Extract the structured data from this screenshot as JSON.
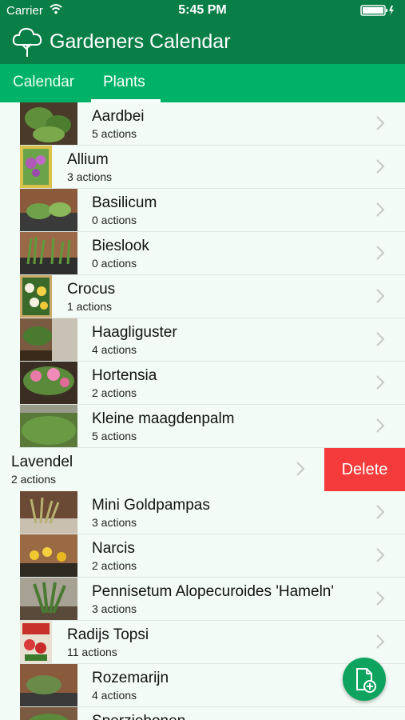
{
  "status": {
    "carrier": "Carrier",
    "time": "5:45 PM"
  },
  "header": {
    "title": "Gardeners Calendar",
    "icon": "tree-cloud-icon"
  },
  "tabs": [
    {
      "label": "Calendar",
      "active": false
    },
    {
      "label": "Plants",
      "active": true
    }
  ],
  "plants": [
    {
      "name": "Aardbei",
      "actions": "5 actions"
    },
    {
      "name": "Allium",
      "actions": "3 actions"
    },
    {
      "name": "Basilicum",
      "actions": "0 actions"
    },
    {
      "name": "Bieslook",
      "actions": "0 actions"
    },
    {
      "name": "Crocus",
      "actions": "1 actions"
    },
    {
      "name": "Haagliguster",
      "actions": "4 actions"
    },
    {
      "name": "Hortensia",
      "actions": "2 actions"
    },
    {
      "name": "Kleine maagdenpalm",
      "actions": "5 actions"
    },
    {
      "name": "Lavendel",
      "actions": "2 actions"
    },
    {
      "name": "Mini Goldpampas",
      "actions": "3 actions"
    },
    {
      "name": "Narcis",
      "actions": "2 actions"
    },
    {
      "name": "Pennisetum Alopecuroides 'Hameln'",
      "actions": "3 actions"
    },
    {
      "name": "Radijs Topsi",
      "actions": "11 actions"
    },
    {
      "name": "Rozemarijn",
      "actions": "4 actions"
    },
    {
      "name": "Sperziebonen",
      "actions": ""
    }
  ],
  "swipe": {
    "delete_label": "Delete"
  },
  "fab": {
    "icon": "add-document-icon"
  },
  "colors": {
    "primary": "#0a7e47",
    "tabbar": "#00b267",
    "delete": "#f23b3a",
    "fab": "#0ea45f"
  }
}
